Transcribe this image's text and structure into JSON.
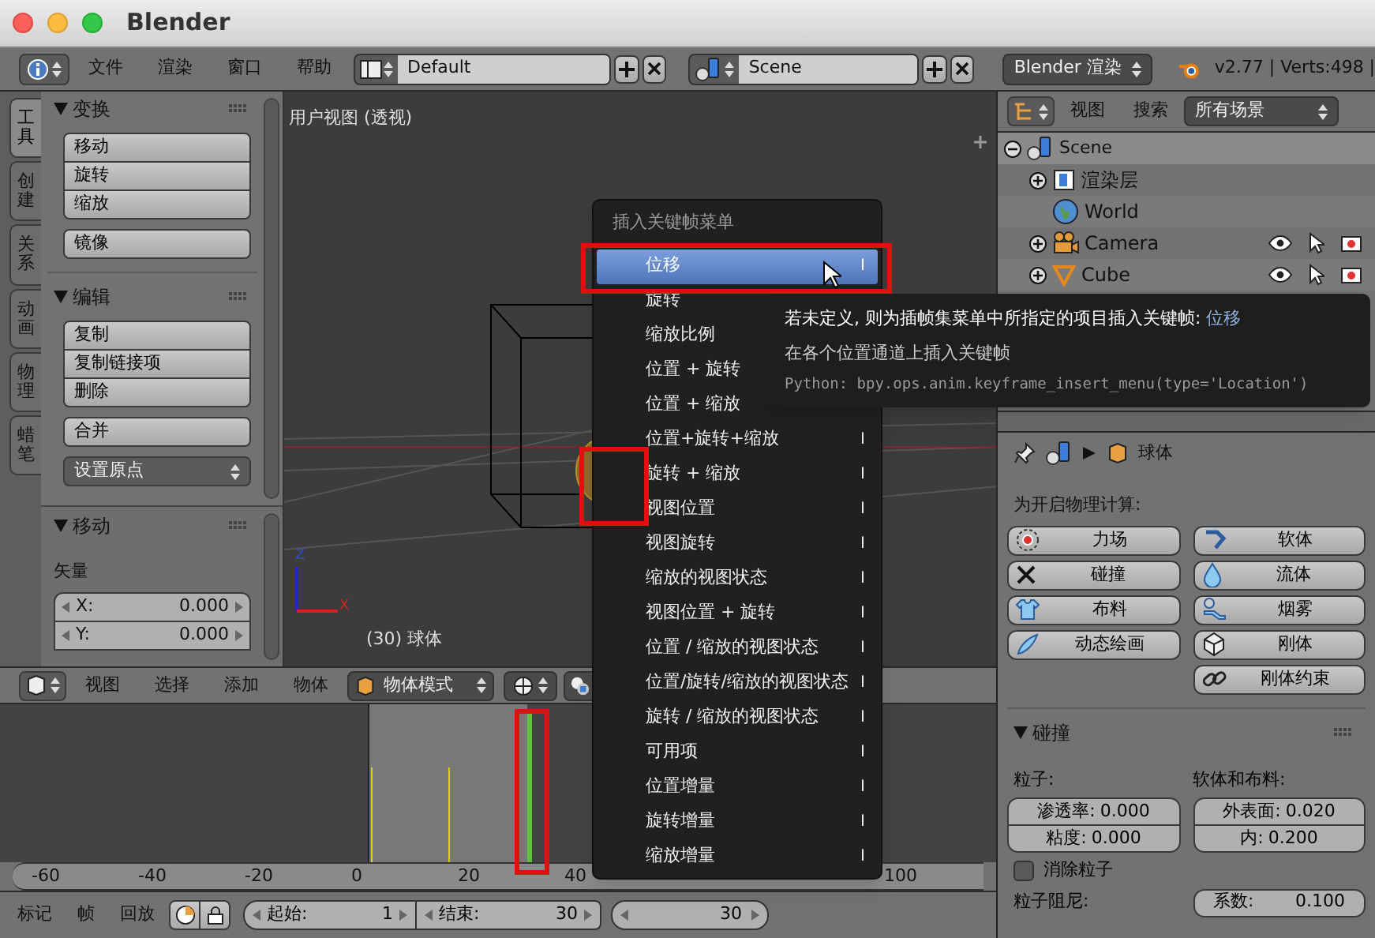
{
  "window": {
    "title": "Blender"
  },
  "menubar": {
    "menus": [
      "文件",
      "渲染",
      "窗口",
      "帮助"
    ],
    "layout": "Default",
    "scene": "Scene",
    "engine": "Blender 渲染",
    "stats": "v2.77 | Verts:498 |"
  },
  "tool_tabs": [
    {
      "label": "工具",
      "selected": true
    },
    {
      "label": "创建",
      "selected": false
    },
    {
      "label": "关系",
      "selected": false
    },
    {
      "label": "动画",
      "selected": false
    },
    {
      "label": "物理",
      "selected": false
    },
    {
      "label": "蜡笔",
      "selected": false
    }
  ],
  "tool_panels": [
    {
      "title": "变换",
      "groups": [
        [
          "移动",
          "旋转",
          "缩放"
        ],
        [
          "镜像"
        ]
      ]
    },
    {
      "title": "编辑",
      "groups": [
        [
          "复制",
          "复制链接项",
          "删除"
        ],
        [
          "合并"
        ]
      ],
      "dropdown": "设置原点"
    }
  ],
  "operator_panel": {
    "title": "移动",
    "subtitle": "矢量",
    "fields": [
      {
        "label": "X:",
        "value": "0.000"
      },
      {
        "label": "Y:",
        "value": "0.000"
      }
    ]
  },
  "viewport": {
    "view_label": "用户视图 (透视)",
    "object_label": "(30) 球体",
    "axis_z": "Z",
    "axis_x": "X"
  },
  "viewport_header": {
    "menus": [
      "视图",
      "选择",
      "添加",
      "物体"
    ],
    "mode": "物体模式"
  },
  "timeline": {
    "ruler": [
      "-60",
      "-40",
      "-20",
      "0",
      "20",
      "40",
      "100"
    ]
  },
  "playback": {
    "menus": [
      "标记",
      "帧",
      "回放"
    ],
    "start_label": "起始:",
    "start": "1",
    "end_label": "结束:",
    "end": "30",
    "current": "30"
  },
  "keyframe_menu": {
    "title": "插入关键帧菜单",
    "items": [
      {
        "label": "位移",
        "shortcut": "I",
        "selected": true
      },
      {
        "label": "旋转",
        "selected": false
      },
      {
        "label": "缩放比例",
        "selected": false
      },
      {
        "label": "位置 + 旋转",
        "selected": false
      },
      {
        "label": "位置 + 缩放",
        "selected": false
      },
      {
        "label": "位置+旋转+缩放",
        "shortcut": "I",
        "selected": false
      },
      {
        "label": "旋转 + 缩放",
        "shortcut": "I",
        "selected": false
      },
      {
        "label": "视图位置",
        "shortcut": "I",
        "selected": false
      },
      {
        "label": "视图旋转",
        "shortcut": "I",
        "selected": false
      },
      {
        "label": "缩放的视图状态",
        "shortcut": "I",
        "selected": false
      },
      {
        "label": "视图位置 + 旋转",
        "shortcut": "I",
        "selected": false
      },
      {
        "label": "位置 / 缩放的视图状态",
        "shortcut": "I",
        "selected": false
      },
      {
        "label": "位置/旋转/缩放的视图状态",
        "shortcut": "I",
        "selected": false
      },
      {
        "label": "旋转 / 缩放的视图状态",
        "shortcut": "I",
        "selected": false
      },
      {
        "label": "可用项",
        "shortcut": "I",
        "selected": false
      },
      {
        "label": "位置增量",
        "shortcut": "I",
        "selected": false
      },
      {
        "label": "旋转增量",
        "shortcut": "I",
        "selected": false
      },
      {
        "label": "缩放增量",
        "shortcut": "I",
        "selected": false
      }
    ]
  },
  "tooltip": {
    "title": "若未定义, 则为插帧集菜单中所指定的项目插入关键帧:",
    "value": "位移",
    "description": "在各个位置通道上插入关键帧",
    "python": "Python: bpy.ops.anim.keyframe_insert_menu(type='Location')"
  },
  "outliner": {
    "menus": [
      "视图",
      "搜索"
    ],
    "filter": "所有场景",
    "tree": [
      {
        "label": "Scene",
        "kind": "scene",
        "expanded": true,
        "children": [
          {
            "label": "渲染层",
            "kind": "renderlayer",
            "expanded": false
          },
          {
            "label": "World",
            "kind": "world"
          },
          {
            "label": "Camera",
            "kind": "camera",
            "expanded": false
          },
          {
            "label": "Cube",
            "kind": "mesh",
            "expanded": false
          }
        ]
      }
    ]
  },
  "properties": {
    "breadcrumb": "球体",
    "physics_heading": "为开启物理计算:",
    "physics_left": [
      {
        "label": "力场",
        "kind": "force"
      },
      {
        "label": "碰撞",
        "kind": "collision"
      },
      {
        "label": "布料",
        "kind": "cloth"
      },
      {
        "label": "动态绘画",
        "kind": "paint"
      }
    ],
    "physics_right": [
      {
        "label": "软体",
        "kind": "softbody"
      },
      {
        "label": "流体",
        "kind": "fluid"
      },
      {
        "label": "烟雾",
        "kind": "smoke"
      },
      {
        "label": "刚体",
        "kind": "rigidbody"
      },
      {
        "label": "刚体约束",
        "kind": "constraint"
      }
    ],
    "collision": {
      "title": "碰撞",
      "particles_heading": "粒子:",
      "softbody_heading": "软体和布料:",
      "left_fields": [
        {
          "label": "渗透率:",
          "value": "0.000"
        },
        {
          "label": "粘度:",
          "value": "0.000"
        }
      ],
      "right_fields": [
        {
          "label": "外表面:",
          "value": "0.020"
        },
        {
          "label": "内:",
          "value": "0.200"
        }
      ],
      "checkbox": {
        "label": "消除粒子",
        "checked": false
      },
      "damping_heading": "粒子阻尼:",
      "factor": {
        "label": "系数:",
        "value": "0.100"
      }
    }
  }
}
